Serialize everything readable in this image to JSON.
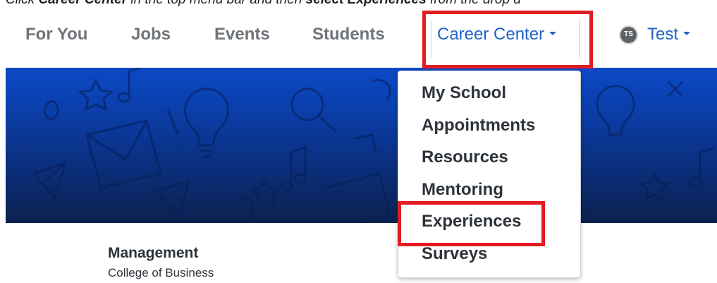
{
  "instruction": {
    "prefix": "Click ",
    "target": "Career Center",
    "middle": " in the top menu bar and then ",
    "action": "select ",
    "item": "Experiences",
    "suffix": " from the drop d"
  },
  "topnav": {
    "items": [
      {
        "label": "For You"
      },
      {
        "label": "Jobs"
      },
      {
        "label": "Events"
      },
      {
        "label": "Students"
      },
      {
        "label": "Career Center"
      }
    ],
    "user": {
      "initials": "TS",
      "name": "Test"
    }
  },
  "dropdown": {
    "items": [
      {
        "label": "My School"
      },
      {
        "label": "Appointments"
      },
      {
        "label": "Resources"
      },
      {
        "label": "Mentoring"
      },
      {
        "label": "Experiences"
      },
      {
        "label": "Surveys"
      }
    ]
  },
  "profile": {
    "program": "Management",
    "college": "College of Business"
  },
  "colors": {
    "accent": "#1f63c6",
    "highlight": "#e21c21",
    "banner_top": "#0c49c7",
    "banner_bottom": "#0b224f",
    "nav_text": "#6f7479"
  },
  "icons": {
    "nav_caret": "caret-down-icon",
    "avatar": "avatar-initials",
    "banner_pattern": [
      "lightbulb-icon",
      "star-icon",
      "envelope-icon",
      "music-note-icon",
      "magnifier-icon",
      "paper-plane-icon"
    ]
  }
}
